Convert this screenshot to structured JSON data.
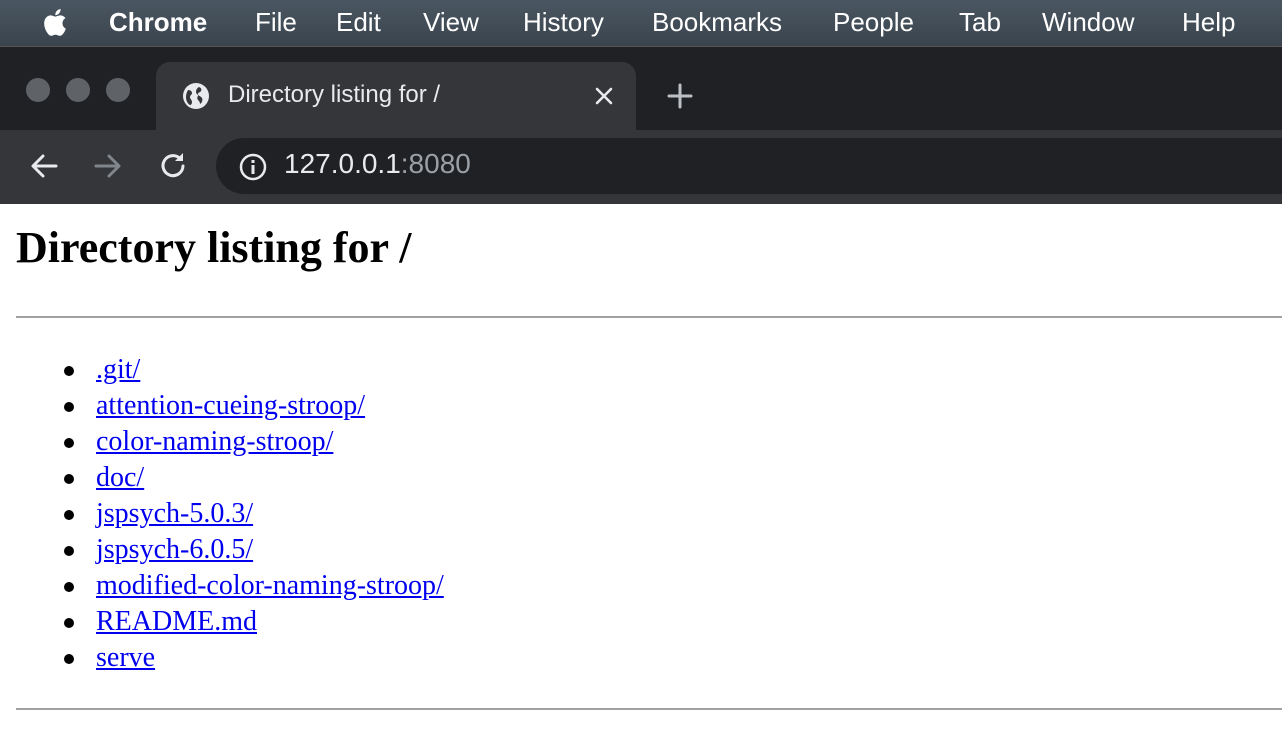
{
  "menubar": {
    "app_name": "Chrome",
    "items": [
      "File",
      "Edit",
      "View",
      "History",
      "Bookmarks",
      "People",
      "Tab",
      "Window",
      "Help"
    ]
  },
  "browser": {
    "tab_title": "Directory listing for /",
    "url_host": "127.0.0.1",
    "url_port": ":8080",
    "icons": {
      "tab": "globe-icon",
      "close": "close-icon",
      "new_tab": "plus-icon",
      "back": "back-arrow-icon",
      "forward": "forward-arrow-icon",
      "reload": "reload-icon",
      "site_info": "info-icon"
    }
  },
  "page": {
    "heading": "Directory listing for /",
    "entries": [
      ".git/",
      "attention-cueing-stroop/",
      "color-naming-stroop/",
      "doc/",
      "jspsych-5.0.3/",
      "jspsych-6.0.5/",
      "modified-color-naming-stroop/",
      "README.md",
      "serve"
    ]
  },
  "colors": {
    "link": "#0000ee",
    "tabstrip": "#202124",
    "toolbar": "#35363a",
    "menubar": "#3f4a54"
  }
}
